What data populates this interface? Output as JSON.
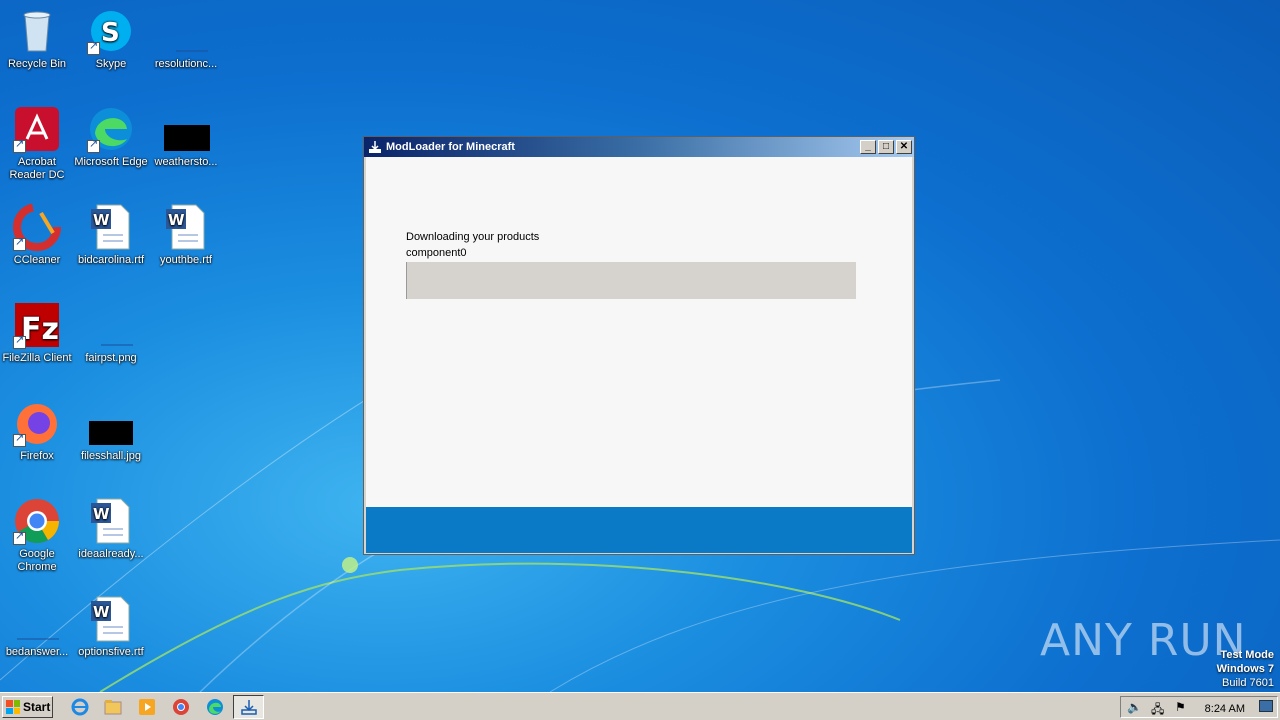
{
  "desktop": {
    "icons": [
      {
        "label": "Recycle Bin"
      },
      {
        "label": "Skype"
      },
      {
        "label": "resolutionc..."
      },
      {
        "label": "Acrobat Reader DC"
      },
      {
        "label": "Microsoft Edge"
      },
      {
        "label": "weathersto..."
      },
      {
        "label": "CCleaner"
      },
      {
        "label": "bidcarolina.rtf"
      },
      {
        "label": "youthbe.rtf"
      },
      {
        "label": "FileZilla Client"
      },
      {
        "label": "fairpst.png"
      },
      {
        "label": "Firefox"
      },
      {
        "label": "filesshall.jpg"
      },
      {
        "label": "Google Chrome"
      },
      {
        "label": "ideaalready..."
      },
      {
        "label": "bedanswer..."
      },
      {
        "label": "optionsfive.rtf"
      }
    ]
  },
  "window": {
    "title": "ModLoader for Minecraft",
    "minimize": "_",
    "maximize": "□",
    "close": "✕",
    "status_line": "Downloading your products",
    "component_line": "component0",
    "progress": 0
  },
  "taskbar": {
    "start_label": "Start",
    "clock": "8:24 AM"
  },
  "watermark": {
    "brand": "ANY RUN",
    "test_mode": "Test Mode",
    "os": "Windows 7",
    "build": "Build 7601"
  },
  "colors": {
    "accent": "#0a7ac6",
    "progress_track": "#d6d3ce"
  }
}
